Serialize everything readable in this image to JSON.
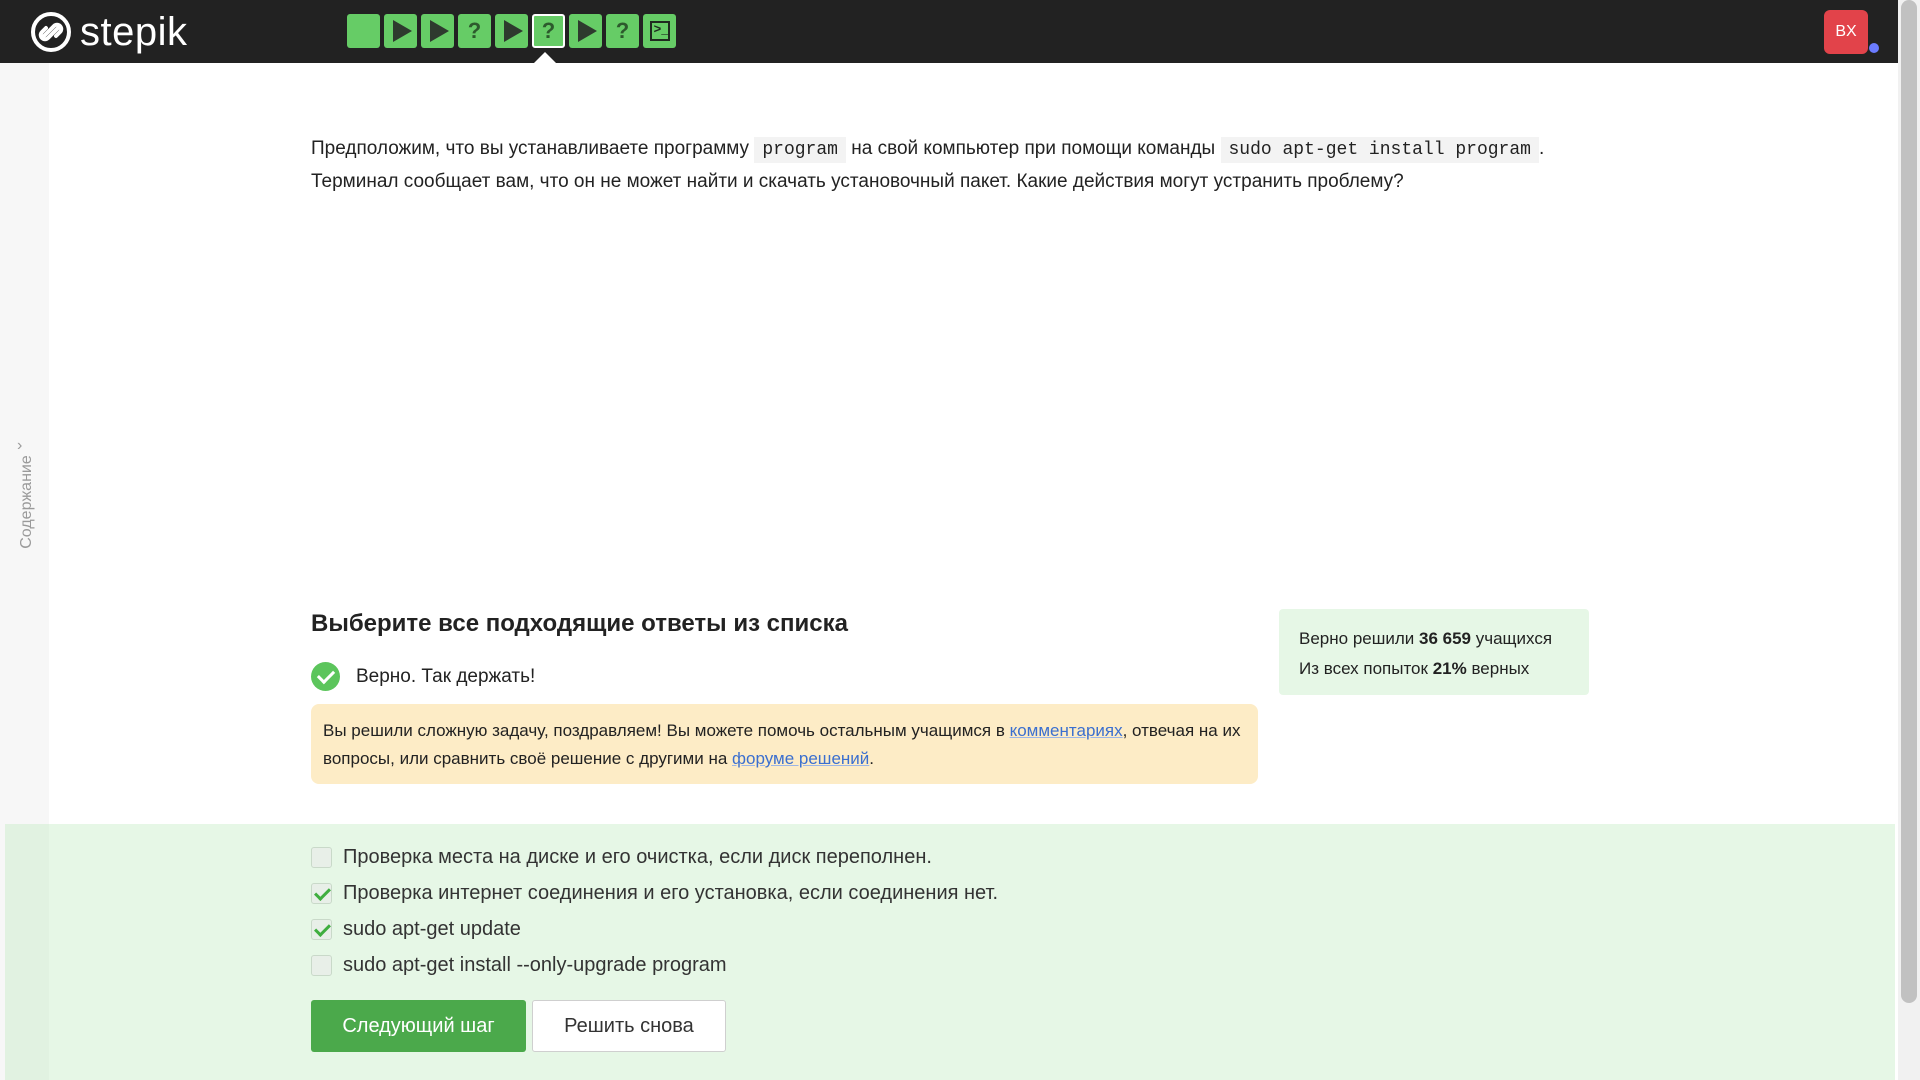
{
  "header": {
    "logo_text": "stepik",
    "steps": [
      {
        "type": "text-step",
        "icon": "square-icon"
      },
      {
        "type": "video",
        "icon": "play-icon"
      },
      {
        "type": "video",
        "icon": "play-icon"
      },
      {
        "type": "quiz",
        "icon": "question-icon",
        "label": "?"
      },
      {
        "type": "video",
        "icon": "play-icon"
      },
      {
        "type": "quiz",
        "icon": "question-icon",
        "label": "?",
        "current": true
      },
      {
        "type": "video",
        "icon": "play-icon"
      },
      {
        "type": "quiz",
        "icon": "question-icon",
        "label": "?"
      },
      {
        "type": "terminal",
        "icon": "terminal-icon",
        "label": ">_"
      }
    ],
    "avatar_initials": "BX"
  },
  "sidebar": {
    "toc_label": "Содержание",
    "toc_chevron": "›"
  },
  "question": {
    "part1": "Предположим, что вы устанавливаете программу ",
    "code1": "program",
    "part2": " на свой компьютер при помощи команды ",
    "code2": "sudo apt-get install program",
    "part3": ". Терминал сообщает вам, что он не может найти и скачать установочный пакет. Какие действия могут устранить проблему?"
  },
  "quiz": {
    "title": "Выберите все подходящие ответы из списка",
    "correct_text": "Верно. Так держать!",
    "congrats": {
      "text1": "Вы решили сложную задачу, поздравляем! Вы можете помочь остальным учащимся в ",
      "link1": "комментариях",
      "text2": ", отвечая на их вопросы, или сравнить своё решение с другими на ",
      "link2": "форуме решений",
      "text3": "."
    },
    "stats": {
      "solved_prefix": "Верно решили ",
      "solved_count": "36 659",
      "solved_suffix": " учащихся",
      "attempts_prefix": "Из всех попыток ",
      "attempts_percent": "21%",
      "attempts_suffix": " верных"
    },
    "options": [
      {
        "label": "Проверка места на диске и его очистка, если диск переполнен.",
        "checked": false
      },
      {
        "label": "Проверка интернет соединения и его установка, если соединения нет.",
        "checked": true
      },
      {
        "label": "sudo apt-get update",
        "checked": true
      },
      {
        "label": "sudo apt-get install --only-upgrade program",
        "checked": false
      }
    ],
    "next_button": "Следующий шаг",
    "again_button": "Решить снова"
  },
  "colors": {
    "topbar": "#222222",
    "step_green": "#66cc66",
    "accent_green": "#4ba94b",
    "answers_bg": "#e6f7e6",
    "congrats_bg": "#fdecc6",
    "avatar_red": "#e2434a",
    "link": "#3b6fcf"
  }
}
